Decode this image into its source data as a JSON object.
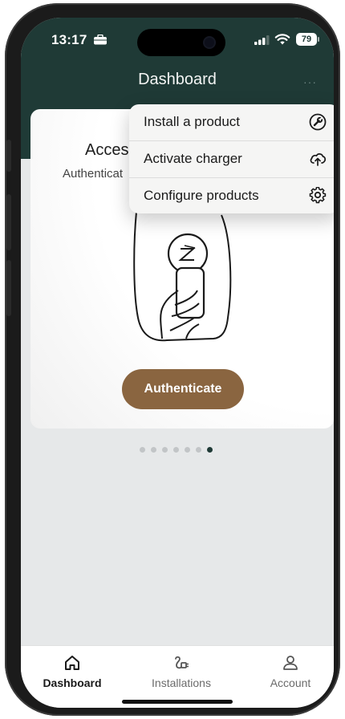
{
  "status_bar": {
    "time": "13:17",
    "battery": "79",
    "icons": [
      "briefcase-icon",
      "signal-icon",
      "wifi-icon",
      "battery-icon"
    ]
  },
  "header": {
    "title": "Dashboard",
    "more": "···"
  },
  "card": {
    "title": "Acces",
    "subtitle": "Authenticat",
    "button_label": "Authenticate"
  },
  "carousel": {
    "total": 7,
    "active_index": 6
  },
  "menu": {
    "items": [
      {
        "label": "Install a product",
        "icon": "wrench-icon"
      },
      {
        "label": "Activate charger",
        "icon": "cloud-upload-icon"
      },
      {
        "label": "Configure products",
        "icon": "gear-icon"
      }
    ]
  },
  "tabs": [
    {
      "label": "Dashboard",
      "icon": "home-icon",
      "active": true
    },
    {
      "label": "Installations",
      "icon": "charger-plug-icon",
      "active": false
    },
    {
      "label": "Account",
      "icon": "person-icon",
      "active": false
    }
  ],
  "colors": {
    "header_bg": "#1f3a36",
    "screen_bg": "#e6e8e9",
    "accent_button": "#8a6540",
    "active_dot": "#1f3a36"
  }
}
